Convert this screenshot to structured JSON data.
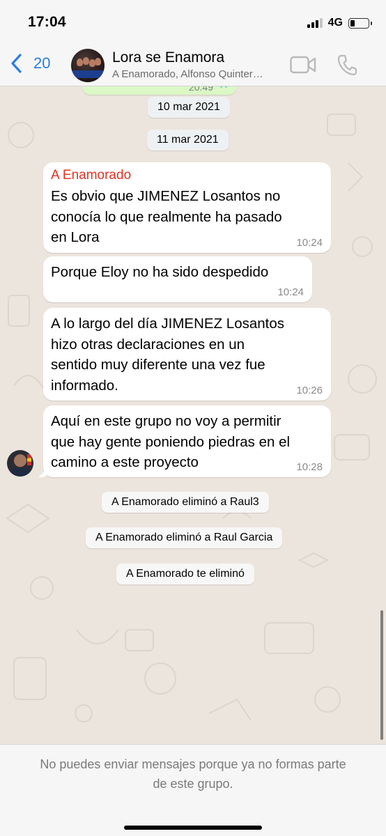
{
  "status_bar": {
    "time": "17:04",
    "network": "4G"
  },
  "header": {
    "back_count": "20",
    "title": "Lora se Enamora",
    "subtitle": "A Enamorado, Alfonso Quinter…",
    "icons": [
      "chevron-left-icon",
      "video-camera-icon",
      "phone-icon"
    ]
  },
  "chat": {
    "previous_message_time": "20:49",
    "dates": [
      "10 mar 2021",
      "11 mar 2021"
    ],
    "messages": [
      {
        "sender": "A Enamorado",
        "text_lines": [
          "Es obvio que JIMENEZ Losantos no",
          "conocía lo que realmente ha pasado",
          "en Lora"
        ],
        "time": "10:24"
      },
      {
        "text_lines": [
          "Porque Eloy no ha sido despedido"
        ],
        "time": "10:24"
      },
      {
        "text_lines": [
          "A lo largo del día JIMENEZ Losantos",
          "hizo otras declaraciones en un",
          "sentido muy diferente una vez fue",
          "informado."
        ],
        "time": "10:26"
      },
      {
        "text_lines": [
          "Aquí en este grupo no voy a permitir",
          "que hay gente poniendo piedras en el",
          "camino a este proyecto"
        ],
        "time": "10:28"
      }
    ],
    "system_notices": [
      "A Enamorado eliminó a Raul3",
      "A Enamorado eliminó a Raul Garcia",
      "A Enamorado te eliminó"
    ]
  },
  "footer": {
    "notice_line1": "No puedes enviar mensajes porque ya no formas parte",
    "notice_line2": "de este grupo."
  },
  "colors": {
    "accent_blue": "#2a7de1",
    "sender_red": "#de3323",
    "chat_background": "#ece5dd",
    "outgoing_bubble": "#dcf8c6"
  }
}
